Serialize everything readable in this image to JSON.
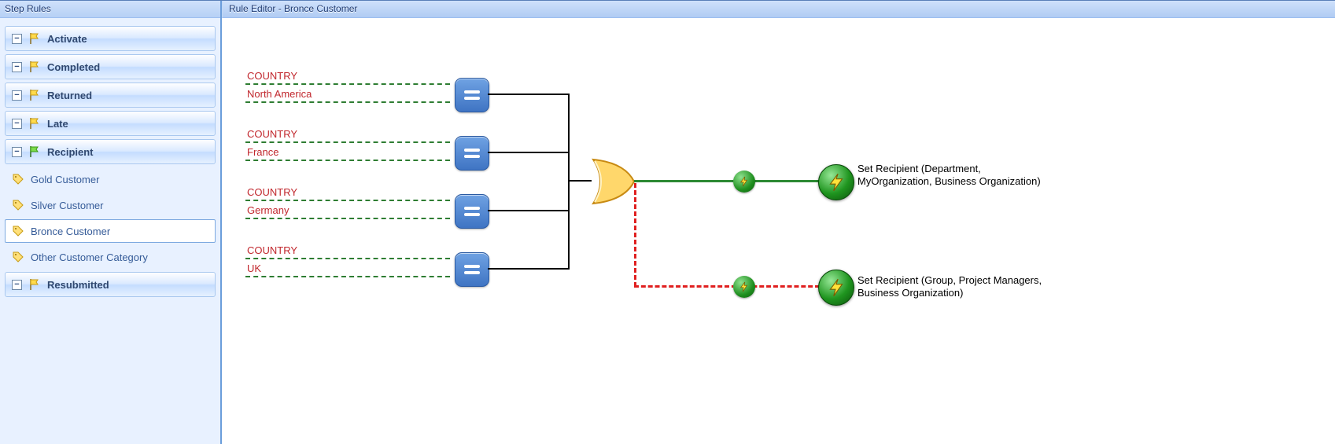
{
  "sidebar": {
    "title": "Step Rules",
    "categories": [
      {
        "label": "Activate",
        "flag": "yellow",
        "expanded": false
      },
      {
        "label": "Completed",
        "flag": "yellow",
        "expanded": false
      },
      {
        "label": "Returned",
        "flag": "yellow",
        "expanded": false
      },
      {
        "label": "Late",
        "flag": "yellow",
        "expanded": false
      },
      {
        "label": "Recipient",
        "flag": "green",
        "expanded": true,
        "children": [
          {
            "label": "Gold Customer"
          },
          {
            "label": "Silver Customer"
          },
          {
            "label": "Bronce Customer",
            "selected": true
          },
          {
            "label": "Other Customer Category"
          }
        ]
      },
      {
        "label": "Resubmitted",
        "flag": "yellow",
        "expanded": false
      }
    ]
  },
  "editor": {
    "title": "Rule Editor - Bronce Customer",
    "conditions": [
      {
        "field": "COUNTRY",
        "value": "North America"
      },
      {
        "field": "COUNTRY",
        "value": "France"
      },
      {
        "field": "COUNTRY",
        "value": "Germany"
      },
      {
        "field": "COUNTRY",
        "value": "UK"
      }
    ],
    "gate": "OR",
    "actions": {
      "true": "Set Recipient (Department, MyOrganization, Business Organization)",
      "false": "Set Recipient (Group, Project Managers, Business Organization)"
    }
  }
}
